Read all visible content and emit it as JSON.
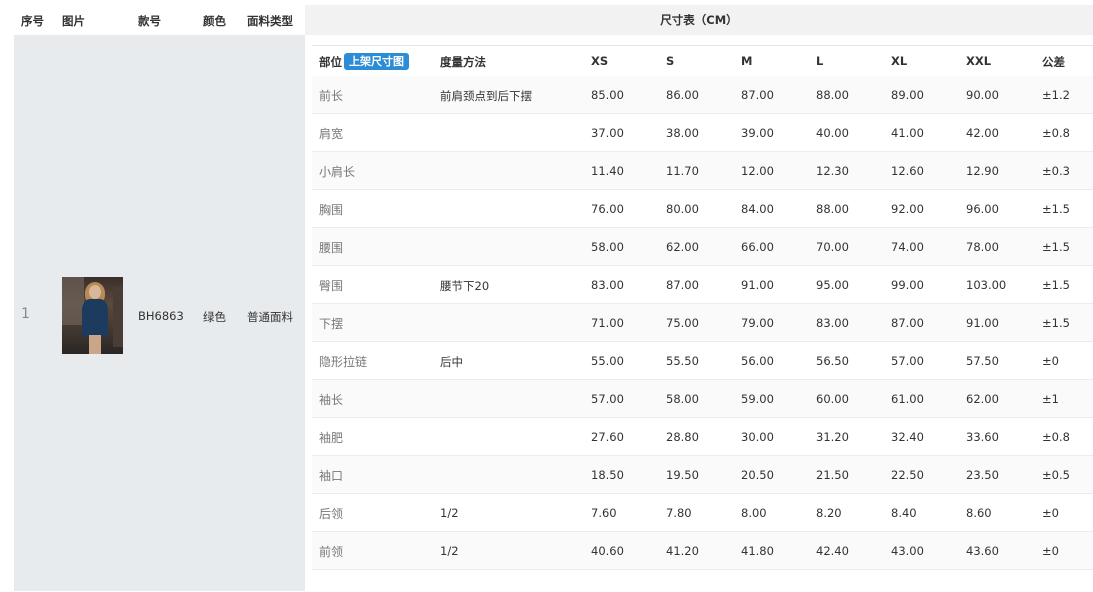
{
  "columns": {
    "seq": "序号",
    "image": "图片",
    "style_no": "款号",
    "color": "颜色",
    "fabric": "面料类型",
    "size_table": "尺寸表（CM）"
  },
  "product": {
    "seq": "1",
    "style_no": "BH6863",
    "color": "绿色",
    "fabric": "普通面料"
  },
  "size_head": {
    "part": "部位",
    "badge": "上架尺寸图",
    "method": "度量方法",
    "sizes": [
      "XS",
      "S",
      "M",
      "L",
      "XL",
      "XXL"
    ],
    "tolerance": "公差"
  },
  "rows": [
    {
      "part": "前长",
      "method": "前肩颈点到后下摆",
      "v": [
        "85.00",
        "86.00",
        "87.00",
        "88.00",
        "89.00",
        "90.00"
      ],
      "tol": "±1.2"
    },
    {
      "part": "肩宽",
      "method": "",
      "v": [
        "37.00",
        "38.00",
        "39.00",
        "40.00",
        "41.00",
        "42.00"
      ],
      "tol": "±0.8"
    },
    {
      "part": "小肩长",
      "method": "",
      "v": [
        "11.40",
        "11.70",
        "12.00",
        "12.30",
        "12.60",
        "12.90"
      ],
      "tol": "±0.3"
    },
    {
      "part": "胸围",
      "method": "",
      "v": [
        "76.00",
        "80.00",
        "84.00",
        "88.00",
        "92.00",
        "96.00"
      ],
      "tol": "±1.5"
    },
    {
      "part": "腰围",
      "method": "",
      "v": [
        "58.00",
        "62.00",
        "66.00",
        "70.00",
        "74.00",
        "78.00"
      ],
      "tol": "±1.5"
    },
    {
      "part": "臀围",
      "method": "腰节下20",
      "v": [
        "83.00",
        "87.00",
        "91.00",
        "95.00",
        "99.00",
        "103.00"
      ],
      "tol": "±1.5"
    },
    {
      "part": "下摆",
      "method": "",
      "v": [
        "71.00",
        "75.00",
        "79.00",
        "83.00",
        "87.00",
        "91.00"
      ],
      "tol": "±1.5"
    },
    {
      "part": "隐形拉链",
      "method": "后中",
      "v": [
        "55.00",
        "55.50",
        "56.00",
        "56.50",
        "57.00",
        "57.50"
      ],
      "tol": "±0"
    },
    {
      "part": "袖长",
      "method": "",
      "v": [
        "57.00",
        "58.00",
        "59.00",
        "60.00",
        "61.00",
        "62.00"
      ],
      "tol": "±1"
    },
    {
      "part": "袖肥",
      "method": "",
      "v": [
        "27.60",
        "28.80",
        "30.00",
        "31.20",
        "32.40",
        "33.60"
      ],
      "tol": "±0.8"
    },
    {
      "part": "袖口",
      "method": "",
      "v": [
        "18.50",
        "19.50",
        "20.50",
        "21.50",
        "22.50",
        "23.50"
      ],
      "tol": "±0.5"
    },
    {
      "part": "后领",
      "method": "1/2",
      "v": [
        "7.60",
        "7.80",
        "8.00",
        "8.20",
        "8.40",
        "8.60"
      ],
      "tol": "±0"
    },
    {
      "part": "前领",
      "method": "1/2",
      "v": [
        "40.60",
        "41.20",
        "41.80",
        "42.40",
        "43.00",
        "43.60"
      ],
      "tol": "±0"
    }
  ],
  "colors": {
    "badge": "#2d8cd6",
    "left_panel_bg": "#e8ebee",
    "header_bg": "#f2f2f2"
  }
}
